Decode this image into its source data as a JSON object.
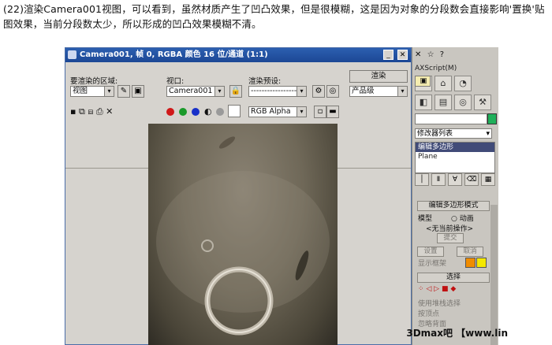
{
  "caption": "(22)渲染Camera001视图，可以看到，虽然材质产生了凹凸效果，但是很模糊，这是因为对象的分段数会直接影响'置换'贴图效果，当前分段数太少，所以形成的凹凸效果模糊不清。",
  "render_window": {
    "title": "Camera001, 帧 0, RGBA 颜色 16 位/通道 (1:1)",
    "area_label": "要渲染的区域:",
    "area_value": "视图",
    "viewport_label": "视口:",
    "viewport_value": "Camera001",
    "preset_label": "渲染预设:",
    "preset_value": "-------------------",
    "render_button": "渲染",
    "quality_value": "产品级",
    "channel_value": "RGB Alpha"
  },
  "command_panel": {
    "maxscript": "AXScript(M)",
    "modifier_list": "修改器列表",
    "stack_items": [
      "编辑多边形",
      "Plane"
    ],
    "rollout_title": "编辑多边形模式",
    "model_label": "模型",
    "anim_label": "动画",
    "no_op": "<无当前操作>",
    "commit": "提交",
    "settings": "设置",
    "cancel": "取消",
    "show_cage": "显示框架",
    "selection_title": "选择",
    "use_stack": "使用堆栈选择",
    "by_vertex": "按顶点",
    "ignore_back": "忽略背面"
  },
  "watermark": "3Dmax吧 【www.lin",
  "colors": {
    "accent_green": "#1fb05a",
    "title_blue": "#2c5fb0"
  }
}
